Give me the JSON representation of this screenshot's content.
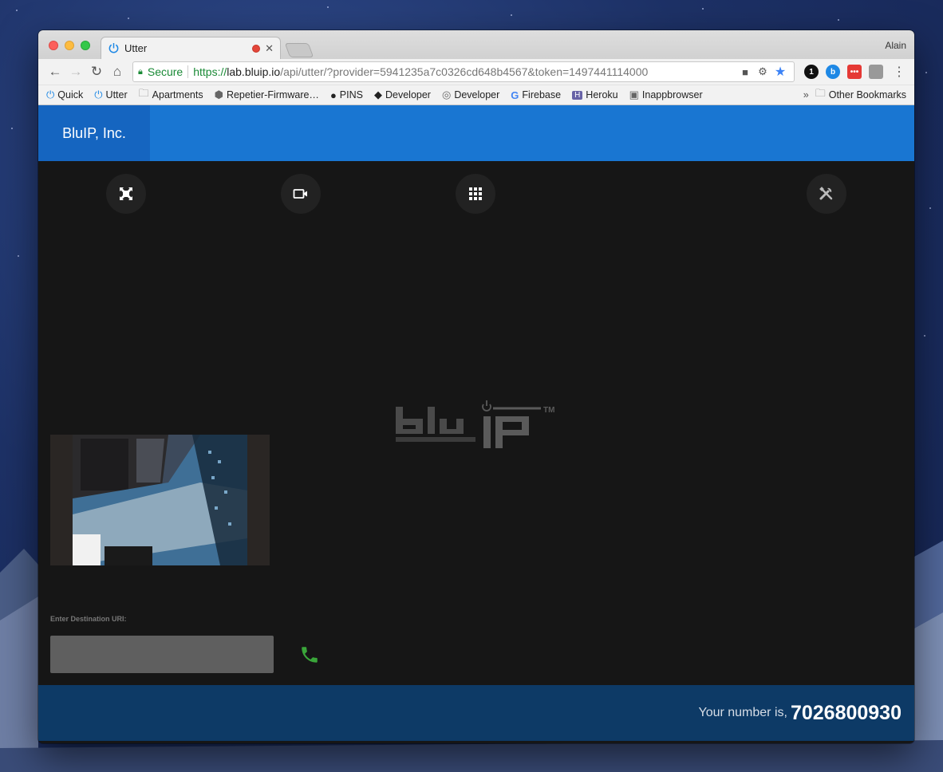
{
  "desktop": {
    "user": "Alain"
  },
  "browser": {
    "tab": {
      "title": "Utter",
      "close": "✕"
    },
    "nav": {
      "back": "←",
      "forward": "→",
      "reload": "↻",
      "home": "⌂"
    },
    "address": {
      "security_label": "Secure",
      "scheme": "https://",
      "host": "lab.bluip.io",
      "path": "/api/utter/?provider=5941235a7c0326cd648b4567&token=1497441114000"
    },
    "extensions": [
      "1",
      "b",
      "•••",
      ""
    ],
    "bookmarks": [
      {
        "label": "Quick",
        "icon": "power-icon"
      },
      {
        "label": "Utter",
        "icon": "power-icon"
      },
      {
        "label": "Apartments",
        "icon": "folder-icon"
      },
      {
        "label": "Repetier-Firmware…",
        "icon": "cube-icon"
      },
      {
        "label": "PINS",
        "icon": "github-icon"
      },
      {
        "label": "Developer",
        "icon": "apple-icon"
      },
      {
        "label": "Developer",
        "icon": "gear-icon"
      },
      {
        "label": "Firebase",
        "icon": "google-icon"
      },
      {
        "label": "Heroku",
        "icon": "heroku-icon"
      },
      {
        "label": "Inappbrowser",
        "icon": "robot-icon"
      }
    ],
    "bookmarks_more": "»",
    "other_bookmarks": "Other Bookmarks"
  },
  "app": {
    "brand": "BluIP, Inc.",
    "controls": [
      "fullscreen-icon",
      "video-camera-icon",
      "dialpad-icon",
      "tools-icon"
    ],
    "logo": {
      "text": "bluIP",
      "tm": "TM"
    },
    "destination": {
      "label": "Enter Destination URI:",
      "value": "",
      "placeholder": ""
    },
    "footer": {
      "label": "Your number is,",
      "number": "7026800930"
    }
  },
  "colors": {
    "header_bg": "#1976d2",
    "brand_bg": "#1565c0",
    "main_bg": "#161616",
    "footer_bg": "#0d3a66",
    "call_green": "#3aa63a"
  }
}
